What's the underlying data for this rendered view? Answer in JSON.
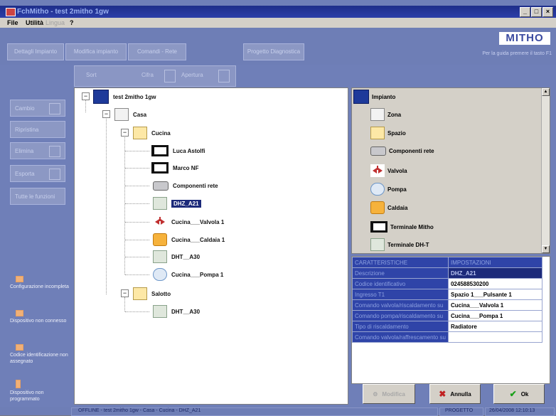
{
  "window": {
    "title": "FchMitho - test 2mitho 1gw"
  },
  "menu": {
    "file": "File",
    "utility": "Utilità",
    "lingua": "Lingua",
    "help": "?"
  },
  "brand": {
    "logo": "MITHO",
    "subtitle": "Per la guida premere il tasto F1"
  },
  "top_buttons": [
    "Dettagli Impianto",
    "Modifica impianto",
    "Comandi - Rete",
    "Progetto Diagnostica"
  ],
  "toolbar": {
    "sort": "Sort",
    "filtro": "Cifra",
    "apertura": "Apertura"
  },
  "left_buttons": [
    "Cambio",
    "Ripristina",
    "Elimina",
    "Esporta",
    "Tutte le funzioni"
  ],
  "legend": [
    "Configurazione incompleta",
    "Dispositivo non connesso",
    "Codice identificazione non assegnato",
    "Dispositivo non programmato"
  ],
  "tree": {
    "root": "test 2mitho 1gw",
    "casa": "Casa",
    "cucina": "Cucina",
    "luca": "Luca Astolfi",
    "marco": "Marco NF",
    "componenti": "Componenti rete",
    "dhz": "DHZ_A21",
    "valvola": "Cucina___Valvola 1",
    "caldaia": "Cucina___Caldaia 1",
    "dht": "DHT__A30",
    "pompa": "Cucina___Pompa 1",
    "salotto": "Salotto",
    "dht2": "DHT__A30"
  },
  "palette": {
    "header": "Impianto",
    "items": [
      "Zona",
      "Spazio",
      "Componenti rete",
      "Valvola",
      "Pompa",
      "Caldaia",
      "Terminale Mitho",
      "Terminale DH-T"
    ]
  },
  "properties": {
    "header_key": "CARATTERISTICHE",
    "header_val": "IMPOSTAZIONI",
    "rows": [
      {
        "key": "Descrizione",
        "value": "DHZ_A21"
      },
      {
        "key": "Codice identificativo",
        "value": "024588530200"
      },
      {
        "key": "Ingresso T1",
        "value": "Spazio 1___Pulsante 1"
      },
      {
        "key": "Comando valvola/riscaldamento su",
        "value": "Cucina___Valvola 1"
      },
      {
        "key": "Comando pompa/riscaldamento su",
        "value": "Cucina___Pompa 1"
      },
      {
        "key": "Tipo di riscaldamento",
        "value": "Radiatore"
      },
      {
        "key": "Comando valvola/raffrescamento su",
        "value": ""
      }
    ]
  },
  "buttons": {
    "modifica": "Modifica",
    "annulla": "Annulla",
    "ok": "Ok"
  },
  "status": {
    "path": "OFFLINE - test 2mitho 1gw - Casa - Cucina - DHZ_A21",
    "mode": "PROGETTO",
    "datetime": "26/04/2008 12:10:13"
  }
}
